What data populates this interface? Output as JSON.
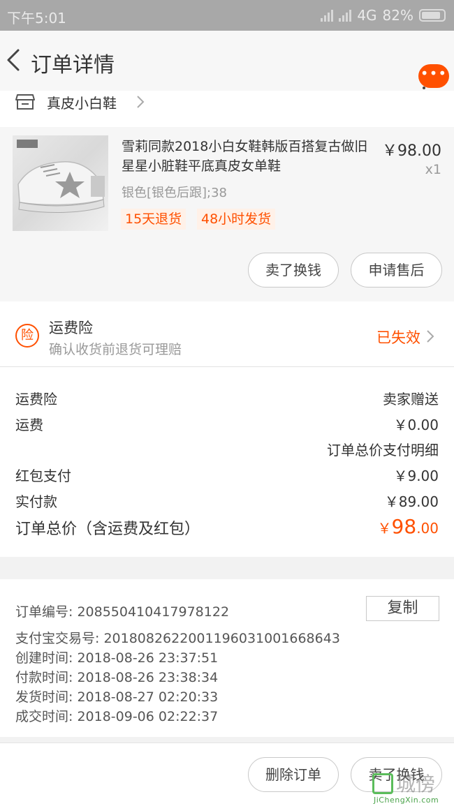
{
  "status_bar": {
    "time": "下午5:01",
    "network": "4G",
    "battery": "82%"
  },
  "nav": {
    "title": "订单详情",
    "more_badge": "•••"
  },
  "store": {
    "name": "真皮小白鞋"
  },
  "product": {
    "title": "雪莉同款2018小白女鞋韩版百搭复古做旧星星小脏鞋平底真皮女单鞋",
    "sku": "银色[银色后跟];38",
    "price": "￥98.00",
    "qty": "x1",
    "tags": [
      "15天退货",
      "48小时发货"
    ],
    "buttons": {
      "sell": "卖了换钱",
      "after_sale": "申请售后"
    }
  },
  "insurance": {
    "icon_text": "险",
    "title": "运费险",
    "subtitle": "确认收货前退货可理赔",
    "status": "已失效"
  },
  "summary": {
    "rows": [
      {
        "label": "运费险",
        "value": "卖家赠送"
      },
      {
        "label": "运费",
        "value": "￥0.00"
      },
      {
        "label": "",
        "value": "订单总价支付明细"
      },
      {
        "label": "红包支付",
        "value": "￥9.00"
      },
      {
        "label": "实付款",
        "value": "￥89.00"
      }
    ],
    "total_label": "订单总价（含运费及红包）",
    "total_currency": "￥",
    "total_int": "98",
    "total_dec": ".00"
  },
  "info": {
    "order_no": "订单编号:  208550410417978122",
    "copy_label": "复制",
    "alipay_no": "支付宝交易号:  2018082622001196031001668643",
    "created": "创建时间:  2018-08-26 23:37:51",
    "paid": "付款时间:  2018-08-26 23:38:34",
    "shipped": "发货时间:  2018-08-27 02:20:33",
    "closed": "成交时间:  2018-09-06 02:22:37"
  },
  "bottom": {
    "delete_label": "删除订单",
    "sell_label": "卖了换钱"
  },
  "watermark": {
    "text": "城傍",
    "url": "JiChengXin.com"
  },
  "colors": {
    "accent": "#ff5000",
    "status_bar": "#a8a8a8",
    "text": "#333333",
    "muted": "#999999"
  }
}
